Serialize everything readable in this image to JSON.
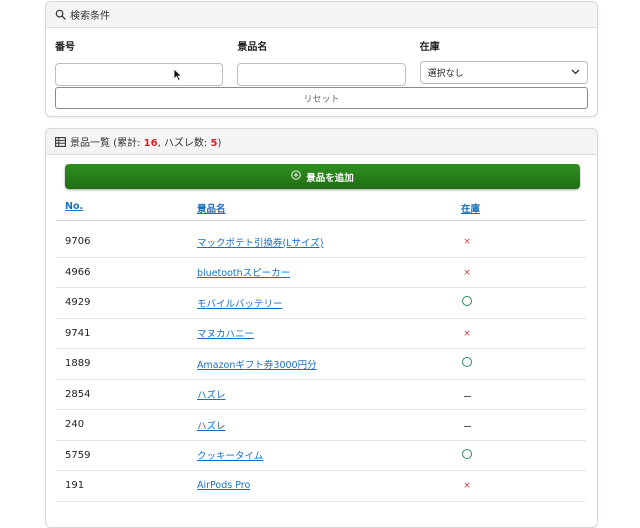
{
  "search": {
    "title": "検索条件",
    "labels": {
      "number": "番号",
      "prize_name": "景品名",
      "stock": "在庫"
    },
    "values": {
      "number": "",
      "prize_name": ""
    },
    "stock_selected": "選択なし",
    "reset_label": "リセット"
  },
  "list": {
    "title_prefix": "景品一覧 (累計: ",
    "total": "16",
    "title_mid": ", ハズレ数: ",
    "miss": "5",
    "title_suffix": ")",
    "add_label": "景品を追加",
    "columns": {
      "no": "No.",
      "name": "景品名",
      "stock": "在庫"
    },
    "rows": [
      {
        "no": "9706",
        "name": "マックポテト引換券(Lサイズ)",
        "stock": "×"
      },
      {
        "no": "4966",
        "name": "bluetoothスピーカー",
        "stock": "×"
      },
      {
        "no": "4929",
        "name": "モバイルバッテリー",
        "stock": "○"
      },
      {
        "no": "9741",
        "name": "マヌカハニー",
        "stock": "×"
      },
      {
        "no": "1889",
        "name": "Amazonギフト券3000円分",
        "stock": "○"
      },
      {
        "no": "2854",
        "name": "ハズレ",
        "stock": "－"
      },
      {
        "no": "240",
        "name": "ハズレ",
        "stock": "－"
      },
      {
        "no": "5759",
        "name": "クッキータイム",
        "stock": "○"
      },
      {
        "no": "191",
        "name": "AirPods Pro",
        "stock": "×"
      }
    ]
  },
  "colors": {
    "accent_green": "#2f8f1f",
    "link_blue": "#1a6fc1",
    "count_red": "#d22222",
    "cross_red": "#d33b3b",
    "circle_green": "#2e8b57"
  },
  "icons": {
    "search_header": "search-icon",
    "list_header": "table-icon",
    "add_button": "plus-circle-icon",
    "select_arrow": "chevron-down-icon",
    "cursor": "mouse-pointer-icon"
  }
}
